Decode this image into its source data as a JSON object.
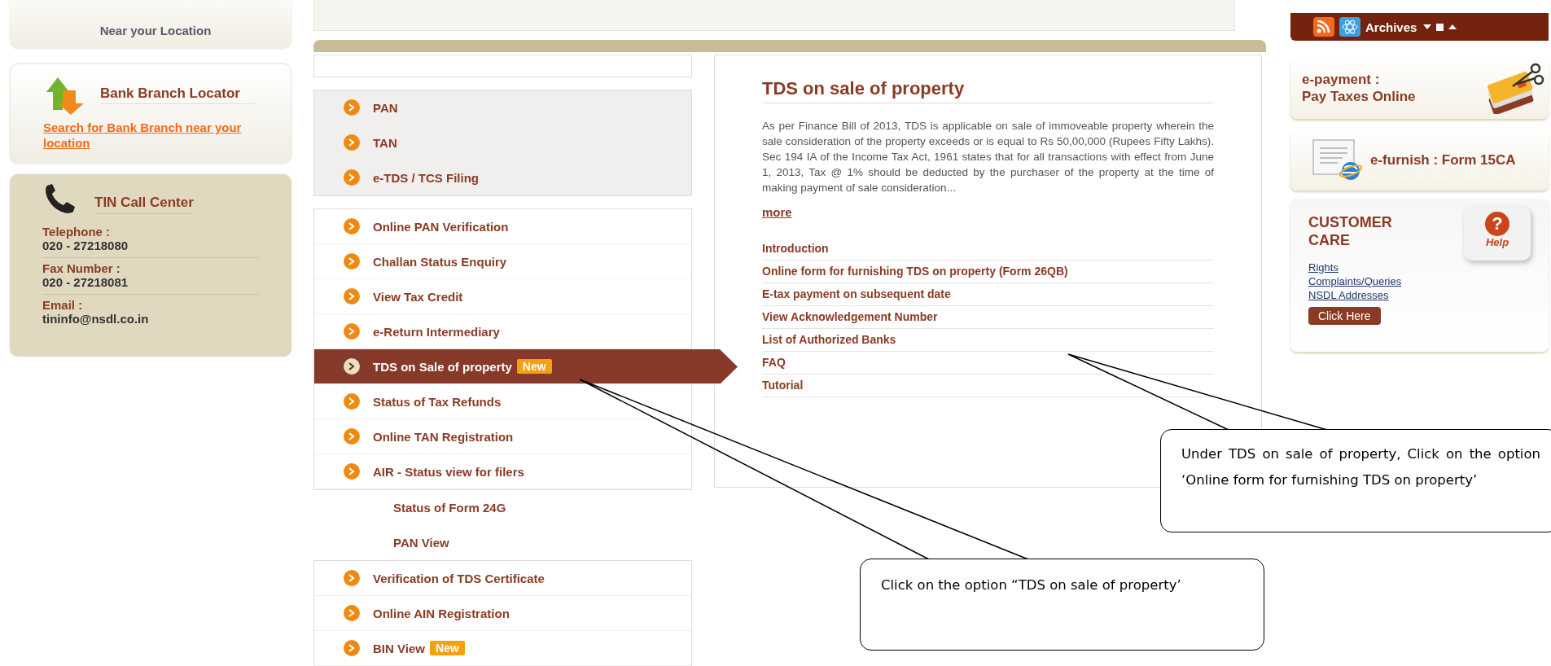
{
  "pan_centres_card": {
    "text": "Near your Location"
  },
  "bank_locator": {
    "title": "Bank Branch Locator",
    "link": "Search for Bank Branch near your location"
  },
  "call_center": {
    "title": "TIN Call Center",
    "contacts": [
      {
        "label": "Telephone :",
        "value": "020 - 27218080"
      },
      {
        "label": "Fax Number :",
        "value": "020 - 27218081"
      },
      {
        "label": "Email :",
        "value": "tininfo@nsdl.co.in"
      }
    ]
  },
  "menu": {
    "groups": [
      {
        "kind": "shaded",
        "items": [
          {
            "label": "PAN",
            "selected": false
          },
          {
            "label": "TAN",
            "selected": false
          },
          {
            "label": "e-TDS / TCS Filing",
            "selected": false
          }
        ]
      },
      {
        "kind": "boxed",
        "items": [
          {
            "label": "Online PAN Verification",
            "selected": false
          },
          {
            "label": "Challan Status Enquiry",
            "selected": false
          },
          {
            "label": "View Tax Credit",
            "selected": false
          },
          {
            "label": "e-Return Intermediary",
            "selected": false
          },
          {
            "label": "TDS on Sale of property",
            "selected": true,
            "badge": "New"
          },
          {
            "label": "Status of Tax Refunds",
            "selected": false
          },
          {
            "label": "Online TAN Registration",
            "selected": false
          },
          {
            "label": "AIR - Status view for filers",
            "selected": false
          }
        ]
      },
      {
        "kind": "plain",
        "items": [
          {
            "label": "Status of Form 24G",
            "selected": false
          },
          {
            "label": "PAN View",
            "selected": false
          }
        ]
      },
      {
        "kind": "open",
        "items": [
          {
            "label": "Verification of TDS Certificate",
            "selected": false
          },
          {
            "label": "Online AIN Registration",
            "selected": false
          },
          {
            "label": "BIN View",
            "selected": false,
            "badge": "New"
          }
        ]
      }
    ]
  },
  "content": {
    "title": "TDS on sale of property",
    "paragraph": "As per Finance Bill of 2013, TDS is applicable on sale of immoveable property wherein the sale consideration of the property exceeds or is equal to Rs 50,00,000 (Rupees Fifty Lakhs). Sec 194 IA of the Income Tax Act, 1961 states that for all transactions with effect from June 1, 2013, Tax @ 1% should be deducted by the purchaser of the property at the time of making payment of sale consideration...",
    "more_link": "more",
    "links": [
      "Introduction",
      "Online form for furnishing TDS on property (Form 26QB)",
      "E-tax payment on subsequent date",
      "View Acknowledgement Number",
      "List of Authorized Banks",
      "FAQ",
      "Tutorial"
    ]
  },
  "right": {
    "archives": {
      "label": "Archives"
    },
    "epayment": {
      "lines": [
        "e-payment :",
        "Pay Taxes Online"
      ]
    },
    "efurnish": {
      "text": "e-furnish : Form 15CA"
    },
    "customer_care": {
      "title": "CUSTOMER CARE",
      "help_symbol": "?",
      "help_label": "Help",
      "links": [
        "Rights",
        "Complaints/Queries",
        "NSDL Addresses"
      ],
      "button": "Click Here"
    }
  },
  "callouts": [
    {
      "text": "Under TDS on sale of property, Click on the option ‘Online form for furnishing TDS on property’"
    },
    {
      "text": "Click on the option “TDS on sale of property’"
    }
  ]
}
